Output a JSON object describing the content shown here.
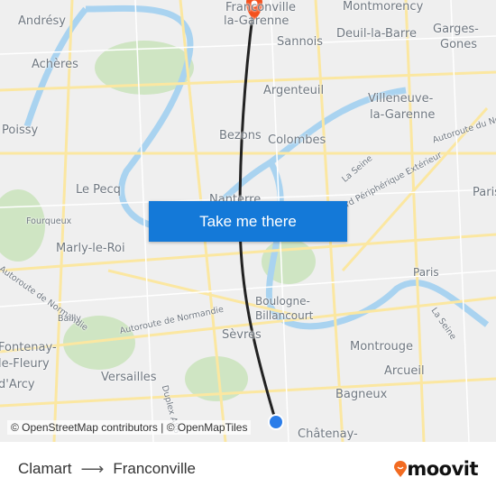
{
  "map": {
    "labels": [
      {
        "text": "Franconville",
        "cls": ""
      },
      {
        "text": "la-Garenne",
        "cls": ""
      },
      {
        "text": "Montmorency",
        "cls": ""
      },
      {
        "text": "Andrésy",
        "cls": ""
      },
      {
        "text": "Sannois",
        "cls": ""
      },
      {
        "text": "Deuil-la-Barre",
        "cls": ""
      },
      {
        "text": "Garges-",
        "cls": ""
      },
      {
        "text": "Gones",
        "cls": ""
      },
      {
        "text": "Achères",
        "cls": ""
      },
      {
        "text": "Argenteuil",
        "cls": "md"
      },
      {
        "text": "Villeneuve-",
        "cls": ""
      },
      {
        "text": "la-Garenne",
        "cls": ""
      },
      {
        "text": "Poissy",
        "cls": ""
      },
      {
        "text": "Bezons",
        "cls": ""
      },
      {
        "text": "Colombes",
        "cls": ""
      },
      {
        "text": "Autoroute du Nord",
        "cls": "sm"
      },
      {
        "text": "La Seine",
        "cls": "sm"
      },
      {
        "text": "Le Pecq",
        "cls": ""
      },
      {
        "text": "Boulevard Périphérique Extérieur",
        "cls": "sm"
      },
      {
        "text": "Paris",
        "cls": ""
      },
      {
        "text": "Nanterre",
        "cls": ""
      },
      {
        "text": "Fourqueux",
        "cls": "sm"
      },
      {
        "text": "Marly-le-Roi",
        "cls": ""
      },
      {
        "text": "Paris",
        "cls": "md"
      },
      {
        "text": "Autoroute de Normandie",
        "cls": "sm"
      },
      {
        "text": "Boulogne-",
        "cls": "md"
      },
      {
        "text": "Billancourt",
        "cls": "md"
      },
      {
        "text": "La Seine",
        "cls": "sm"
      },
      {
        "text": "Bailly",
        "cls": "sm"
      },
      {
        "text": "Autoroute de Normandie",
        "cls": "sm"
      },
      {
        "text": "Sèvres",
        "cls": ""
      },
      {
        "text": "Fontenay-",
        "cls": ""
      },
      {
        "text": "le-Fleury",
        "cls": ""
      },
      {
        "text": "Montrouge",
        "cls": ""
      },
      {
        "text": "Versailles",
        "cls": ""
      },
      {
        "text": "Duplex A86",
        "cls": "sm"
      },
      {
        "text": "Arcueil",
        "cls": ""
      },
      {
        "text": "d'Arcy",
        "cls": ""
      },
      {
        "text": "Bagneux",
        "cls": ""
      },
      {
        "text": "Châtenay-",
        "cls": ""
      }
    ],
    "route_color": "#222222",
    "destination_pin_color": "#f4511e",
    "origin_dot_color": "#2b7de9",
    "water_color": "#a9d3f0",
    "park_color": "#cfe5c3",
    "road_color": "#fbe7a1"
  },
  "cta": {
    "label": "Take me there"
  },
  "attribution": "© OpenStreetMap contributors | © OpenMapTiles",
  "footer": {
    "from": "Clamart",
    "to": "Franconville",
    "arrow": "⟶"
  },
  "brand": {
    "name": "moovit",
    "color": "#f26b21"
  }
}
